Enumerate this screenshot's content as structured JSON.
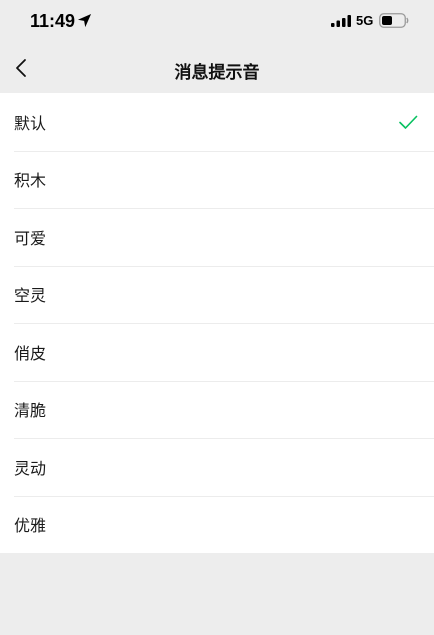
{
  "status_bar": {
    "time": "11:49",
    "network": "5G",
    "icons": [
      "location-arrow-icon",
      "signal-icon",
      "battery-icon"
    ]
  },
  "nav": {
    "title": "消息提示音",
    "back_icon": "chevron-left-icon"
  },
  "sounds": [
    {
      "label": "默认",
      "selected": true
    },
    {
      "label": "积木",
      "selected": false
    },
    {
      "label": "可爱",
      "selected": false
    },
    {
      "label": "空灵",
      "selected": false
    },
    {
      "label": "俏皮",
      "selected": false
    },
    {
      "label": "清脆",
      "selected": false
    },
    {
      "label": "灵动",
      "selected": false
    },
    {
      "label": "优雅",
      "selected": false
    }
  ],
  "colors": {
    "background": "#ededed",
    "list_background": "#ffffff",
    "check": "#07c160",
    "divider": "#ececec"
  }
}
